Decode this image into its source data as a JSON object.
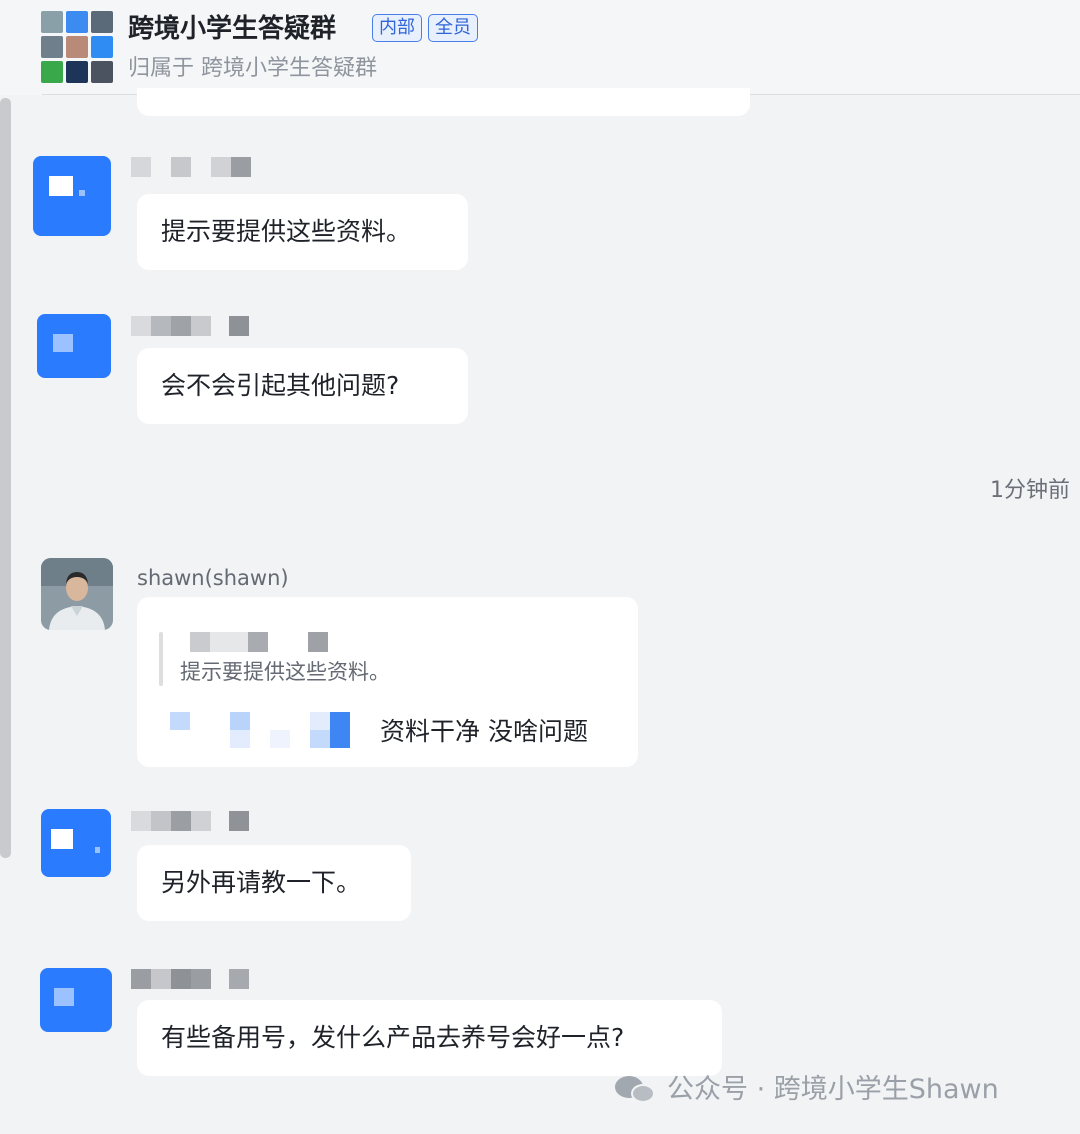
{
  "header": {
    "title": "跨境小学生答疑群",
    "tags": [
      "内部",
      "全员"
    ],
    "subtitle": "归属于 跨境小学生答疑群"
  },
  "messages": [
    {
      "text": "提示要提供这些资料。"
    },
    {
      "text": "会不会引起其他问题?"
    },
    {
      "text": "另外再请教一下。"
    },
    {
      "text": "有些备用号，发什么产品去养号会好一点?"
    }
  ],
  "timestamp": "1分钟前",
  "reply": {
    "sender": "shawn(shawn)",
    "quoted": "提示要提供这些资料。",
    "text": "资料干净 没啥问题"
  },
  "watermark": {
    "text": "公众号 · 跨境小学生Shawn",
    "icon": "wechat-icon"
  },
  "colors": {
    "accent": "#2b7bff",
    "background": "#f2f3f5",
    "bubble": "#ffffff"
  }
}
